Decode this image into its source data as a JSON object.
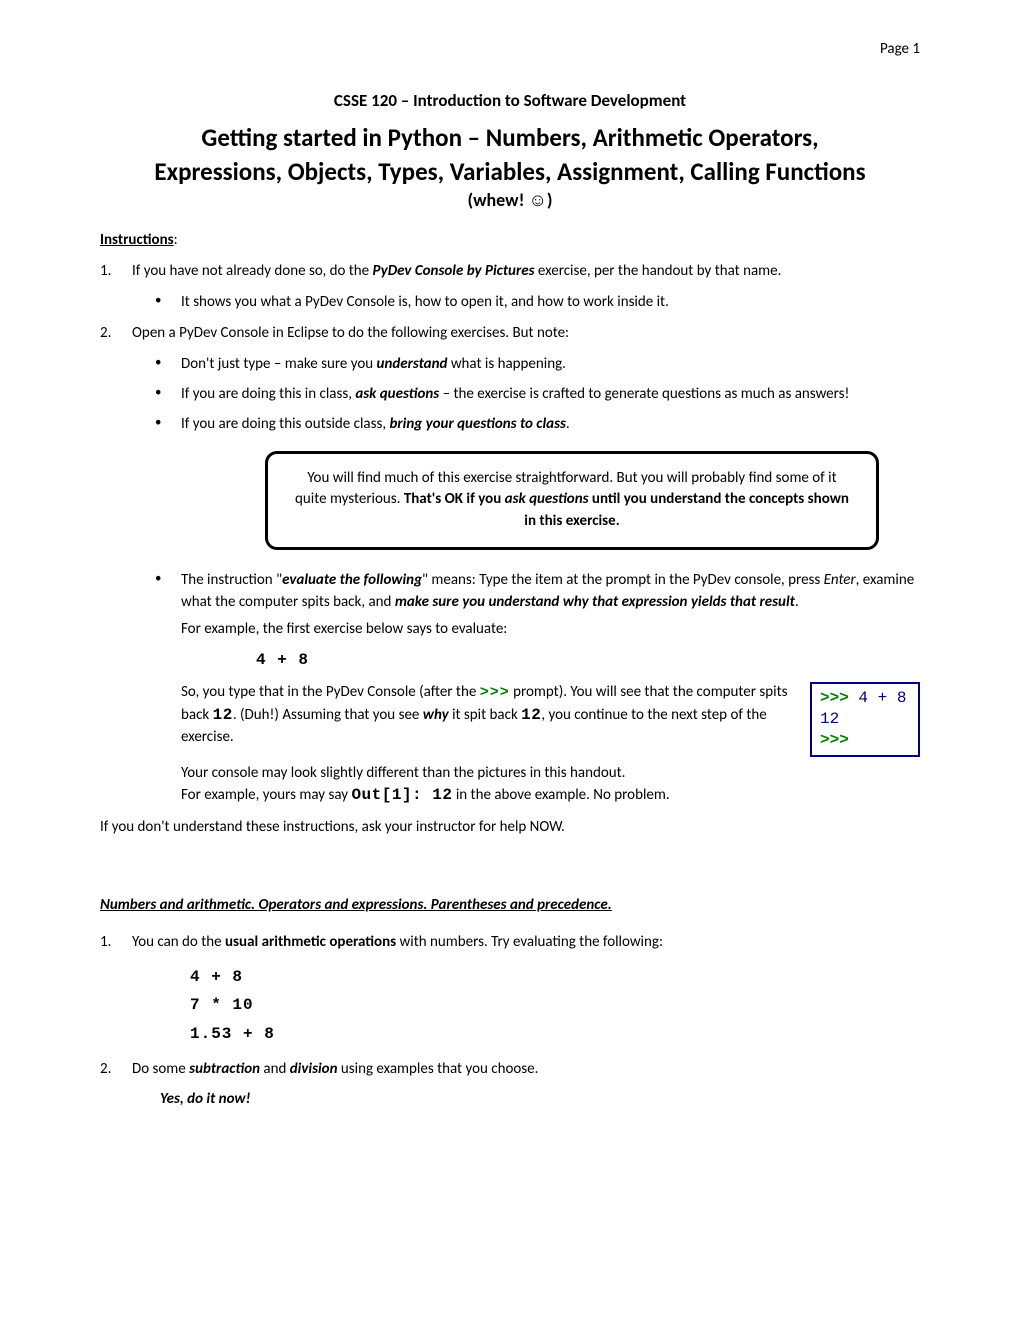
{
  "page_number": "Page 1",
  "course_header": "CSSE 120 – Introduction to Software Development",
  "main_title_line1": "Getting started in Python – Numbers, Arithmetic Operators,",
  "main_title_line2": "Expressions, Objects, Types, Variables, Assignment, Calling Functions",
  "whew": "(whew! ☺)",
  "instructions_label": "Instructions",
  "item1_prefix": "If you have not already done so, do the ",
  "item1_bolditalic": "PyDev Console by Pictures",
  "item1_suffix": " exercise, per the handout by that name.",
  "item1_sub1": "It shows you what a PyDev Console is, how to open it, and how to work inside it.",
  "item2_text": "Open a PyDev Console in Eclipse to do the following exercises.  But note:",
  "item2_sub1_prefix": "Don't just type – make sure you ",
  "item2_sub1_bold": "understand",
  "item2_sub1_suffix": " what is happening.",
  "item2_sub2_prefix": "If you are doing this in class, ",
  "item2_sub2_bold": "ask questions",
  "item2_sub2_suffix": " – the exercise is crafted to generate questions as much as answers!",
  "item2_sub3_prefix": "If you are doing this outside class, ",
  "item2_sub3_bold": "bring your questions to class",
  "item2_sub3_suffix": ".",
  "callout_prefix": "You will find much of this exercise straightforward.  But you will probably find some of it quite mysterious.  ",
  "callout_bold1": "That's OK if you ",
  "callout_bolditalic": "ask questions",
  "callout_bold2": " until you understand the concepts shown in this exercise.",
  "eval_bullet_prefix": "The instruction \"",
  "eval_bullet_bolditalic": "evaluate the following",
  "eval_bullet_mid1": "\" means:  Type the item at the prompt in the PyDev console, press ",
  "eval_bullet_enter": "Enter",
  "eval_bullet_mid2": ", examine what the computer spits back, and ",
  "eval_bullet_bold": "make sure you understand why that expression yields that result",
  "eval_bullet_suffix": ".",
  "for_example_label": "For example, the first exercise below says to evaluate:",
  "code_example_1": "4  + 8",
  "so_you_type_prefix": "So, you type that in the PyDev Console (after the   ",
  "so_you_type_prompt": ">>>",
  "so_you_type_mid": "   prompt).  You will see that the computer spits back ",
  "so_you_type_twelve": "12",
  "so_you_type_mid2": ".  (Duh!)  Assuming that you see ",
  "so_you_type_why": "why",
  "so_you_type_mid3": " it spit back ",
  "so_you_type_twelve2": "12",
  "so_you_type_suffix": ", you continue to the next step of the exercise.",
  "console_prompt": ">>>",
  "console_expr": " 4 + 8",
  "console_result": "12",
  "console_prompt2": ">>>",
  "your_console_line1": "Your console may look slightly different than the pictures in this handout.",
  "your_console_line2_prefix": "For example, yours may say   ",
  "your_console_out": "Out[1]: 12",
  "your_console_line2_suffix": "     in the above example.  No problem.",
  "ask_now": "If you don't understand these instructions, ask your instructor for help NOW.",
  "section1_heading": "Numbers and arithmetic.  Operators and expressions.  Parentheses and precedence.",
  "ex1_prefix": "You can do the ",
  "ex1_bold": "usual arithmetic operations",
  "ex1_suffix": " with numbers.  Try evaluating the following:",
  "ex1_code1": "4 + 8",
  "ex1_code2": "7 * 10",
  "ex1_code3": "1.53 + 8",
  "ex2_prefix": "Do some ",
  "ex2_bold1": "subtraction",
  "ex2_mid": " and ",
  "ex2_bold2": "division",
  "ex2_suffix": " using examples that you choose.",
  "ex2_yes": "Yes, do it now!"
}
